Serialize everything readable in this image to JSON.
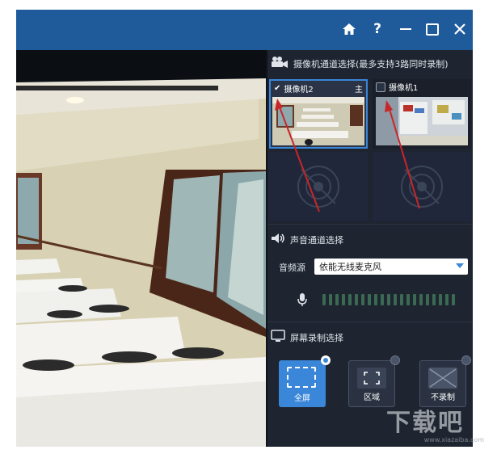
{
  "camera_section": {
    "title": "摄像机通道选择(最多支持3路同时录制)"
  },
  "cameras": [
    {
      "label": "摄像机2",
      "checked": true,
      "badge": "主"
    },
    {
      "label": "摄像机1",
      "checked": false
    }
  ],
  "audio_section": {
    "title": "声音通道选择",
    "source_label": "音频源",
    "source_value": "依能无线麦克风"
  },
  "screen_section": {
    "title": "屏幕录制选择"
  },
  "record_options": [
    {
      "label": "全屏",
      "selected": true
    },
    {
      "label": "区域",
      "selected": false
    },
    {
      "label": "不录制",
      "selected": false
    }
  ],
  "watermark": {
    "logo": "下载吧",
    "url": "www.xiazaiba.com"
  },
  "colors": {
    "accent": "#3a86d8",
    "titlebar": "#1f5a9a",
    "panel": "#1e2430",
    "annotation_arrow": "#c8262a"
  },
  "icons": [
    "home-icon",
    "help-icon",
    "minimize-icon",
    "maximize-icon",
    "close-icon",
    "video-camera-icon",
    "speaker-icon",
    "microphone-icon",
    "monitor-icon",
    "dropdown-arrow-icon"
  ]
}
